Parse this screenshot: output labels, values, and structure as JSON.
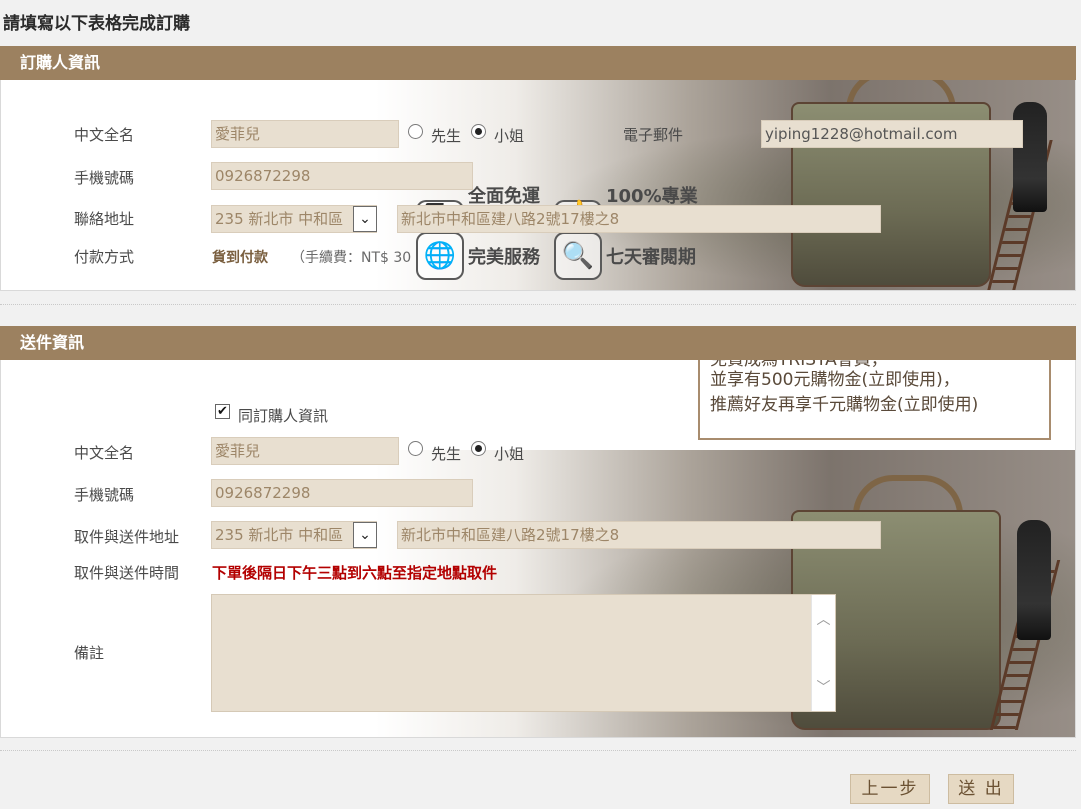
{
  "page_title": "請填寫以下表格完成訂購",
  "buyer": {
    "header": "訂購人資訊",
    "name_label": "中文全名",
    "name_value": "愛菲兒",
    "gender_mr": "先生",
    "gender_ms": "小姐",
    "email_label": "電子郵件",
    "email_value": "yiping1228@hotmail.com",
    "phone_label": "手機號碼",
    "phone_value": "0926872298",
    "address_label": "聯絡地址",
    "address_select": "235 新北市 中和區",
    "address_value": "新北市中和區建八路2號17樓之8",
    "payment_label": "付款方式",
    "payment_method": "貨到付款",
    "payment_fee": "（手續費：NT$ 30"
  },
  "banner_badges": [
    {
      "icon": "globe-icon",
      "text": "完美服務"
    },
    {
      "icon": "magnifier-icon",
      "text": "七天審閱期"
    },
    {
      "icon": "truck-icon",
      "text": "全面免運"
    },
    {
      "icon": "thumbs-up-icon",
      "text": "100%專業"
    }
  ],
  "promo": {
    "line1": "免費成為TRISTA會員，",
    "line2": "並享有500元購物金(立即使用)，",
    "line3": "推薦好友再享千元購物金(立即使用)"
  },
  "delivery": {
    "header": "送件資訊",
    "same_as_buyer": "同訂購人資訊",
    "name_label": "中文全名",
    "name_value": "愛菲兒",
    "gender_mr": "先生",
    "gender_ms": "小姐",
    "phone_label": "手機號碼",
    "phone_value": "0926872298",
    "address_label": "取件與送件地址",
    "address_select": "235 新北市 中和區",
    "address_value": "新北市中和區建八路2號17樓之8",
    "time_label": "取件與送件時間",
    "time_value": "下單後隔日下午三點到六點至指定地點取件",
    "note_label": "備註",
    "note_value": ""
  },
  "buttons": {
    "prev": "上一步",
    "submit": "送 出"
  },
  "colors": {
    "header_bg": "#9c8160",
    "field_bg": "#e8dfd0",
    "accent_red": "#b30000"
  }
}
